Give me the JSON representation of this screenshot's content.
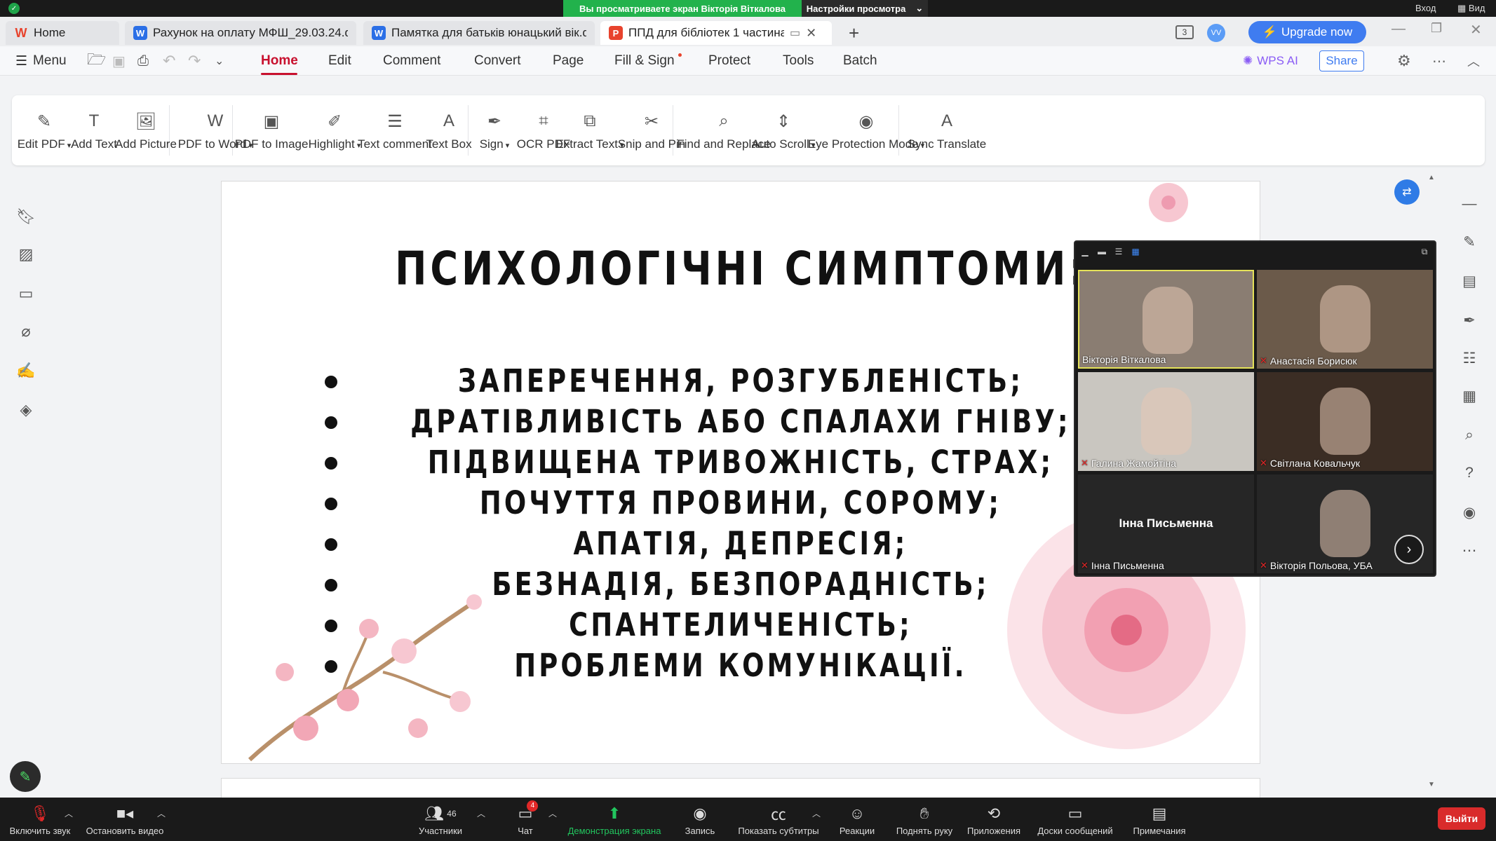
{
  "zoom": {
    "share_notice": "Вы просматриваете экран Вікторія Віткалова",
    "view_settings": "Настройки просмотра",
    "login": "Вход",
    "signin": "Вид"
  },
  "tabs": [
    {
      "label": "Home",
      "icon": "wps-logo-icon",
      "color": "#e8432d"
    },
    {
      "label": "Рахунок на оплату МФШ_29.03.24.do",
      "icon": "word-doc-icon",
      "color": "#2b6fe6"
    },
    {
      "label": "Памятка для батьків юнацький вік.d",
      "icon": "word-doc-icon",
      "color": "#2b6fe6"
    },
    {
      "label": "ППД для бібліотек 1 частина",
      "icon": "pdf-doc-icon",
      "color": "#e8432d"
    }
  ],
  "header": {
    "upgrade": "Upgrade now",
    "avatar": "VV",
    "page_count": "3"
  },
  "menu": {
    "menu_label": "Menu",
    "tabs": [
      "Home",
      "Edit",
      "Comment",
      "Convert",
      "Page",
      "Fill & Sign",
      "Protect",
      "Tools",
      "Batch"
    ],
    "wps_ai": "WPS AI",
    "share": "Share"
  },
  "ribbon": [
    {
      "label": "Edit PDF",
      "icon": "edit-pdf-icon",
      "glyph": "✎",
      "dropdown": true
    },
    {
      "label": "Add Text",
      "icon": "add-text-icon",
      "glyph": "T",
      "dropdown": false
    },
    {
      "label": "Add Picture",
      "icon": "add-picture-icon",
      "glyph": "🖼",
      "dropdown": false
    },
    {
      "label": "PDF to Word",
      "icon": "pdf-to-word-icon",
      "glyph": "W",
      "dropdown": true
    },
    {
      "label": "PDF to Image",
      "icon": "pdf-to-image-icon",
      "glyph": "▣",
      "dropdown": false
    },
    {
      "label": "Highlight",
      "icon": "highlight-icon",
      "glyph": "✐",
      "dropdown": true
    },
    {
      "label": "Text comment",
      "icon": "text-comment-icon",
      "glyph": "☰",
      "dropdown": false
    },
    {
      "label": "Text Box",
      "icon": "text-box-icon",
      "glyph": "A",
      "dropdown": false
    },
    {
      "label": "Sign",
      "icon": "sign-icon",
      "glyph": "✒",
      "dropdown": true
    },
    {
      "label": "OCR PDF",
      "icon": "ocr-icon",
      "glyph": "⌗",
      "dropdown": false
    },
    {
      "label": "Extract Text",
      "icon": "extract-text-icon",
      "glyph": "⧉",
      "dropdown": true
    },
    {
      "label": "Snip and Pin",
      "icon": "snip-icon",
      "glyph": "✂",
      "dropdown": false
    },
    {
      "label": "Find and Replace",
      "icon": "search-icon",
      "glyph": "⌕",
      "dropdown": false
    },
    {
      "label": "Auto Scroll",
      "icon": "auto-scroll-icon",
      "glyph": "⇕",
      "dropdown": true
    },
    {
      "label": "Eye Protection Mode",
      "icon": "eye-icon",
      "glyph": "◉",
      "dropdown": true
    },
    {
      "label": "Sync Translate",
      "icon": "translate-icon",
      "glyph": "A",
      "dropdown": false
    }
  ],
  "slide": {
    "title": "ПСИХОЛОГІЧНІ СИМПТОМИ:",
    "items": [
      "ЗАПЕРЕЧЕННЯ, РОЗГУБЛЕНІСТЬ;",
      "ДРАТІВЛИВІСТЬ АБО СПАЛАХИ ГНІВУ;",
      "ПІДВИЩЕНА ТРИВОЖНІСТЬ, СТРАХ;",
      "ПОЧУТТЯ ПРОВИНИ, СОРОМУ;",
      "АПАТІЯ, ДЕПРЕСІЯ;",
      "БЕЗНАДІЯ, БЕЗПОРАДНІСТЬ;",
      "СПАНТЕЛИЧЕНІСТЬ;",
      "ПРОБЛЕМИ КОМУНІКАЦІЇ."
    ]
  },
  "participants": [
    {
      "name": "Вікторія Віткалова",
      "muted": false,
      "speaking": true,
      "bg": "#8a7d72"
    },
    {
      "name": "Анастасія Борисюк",
      "muted": true,
      "speaking": false,
      "bg": "#6b5a4a"
    },
    {
      "name": "Галина Жамойтіна",
      "muted": true,
      "speaking": false,
      "bg": "#c9c6c0"
    },
    {
      "name": "Світлана Ковальчук",
      "muted": true,
      "speaking": false,
      "bg": "#3b2d24"
    },
    {
      "name": "Інна Письменна",
      "muted": true,
      "speaking": false,
      "bg": "#262626",
      "center_name": "Інна Письменна"
    },
    {
      "name": "Вікторія Польова, УБА",
      "muted": true,
      "speaking": false,
      "bg": "#262626"
    }
  ],
  "bottom": {
    "unmute": "Включить звук",
    "stop_video": "Остановить видео",
    "participants": "Участники",
    "participants_count": "46",
    "chat": "Чат",
    "chat_badge": "4",
    "share_screen": "Демонстрация экрана",
    "record": "Запись",
    "captions": "Показать субтитры",
    "reactions": "Реакции",
    "raise_hand": "Поднять руку",
    "apps": "Приложения",
    "whiteboards": "Доски сообщений",
    "notes": "Примечания",
    "leave": "Выйти"
  }
}
